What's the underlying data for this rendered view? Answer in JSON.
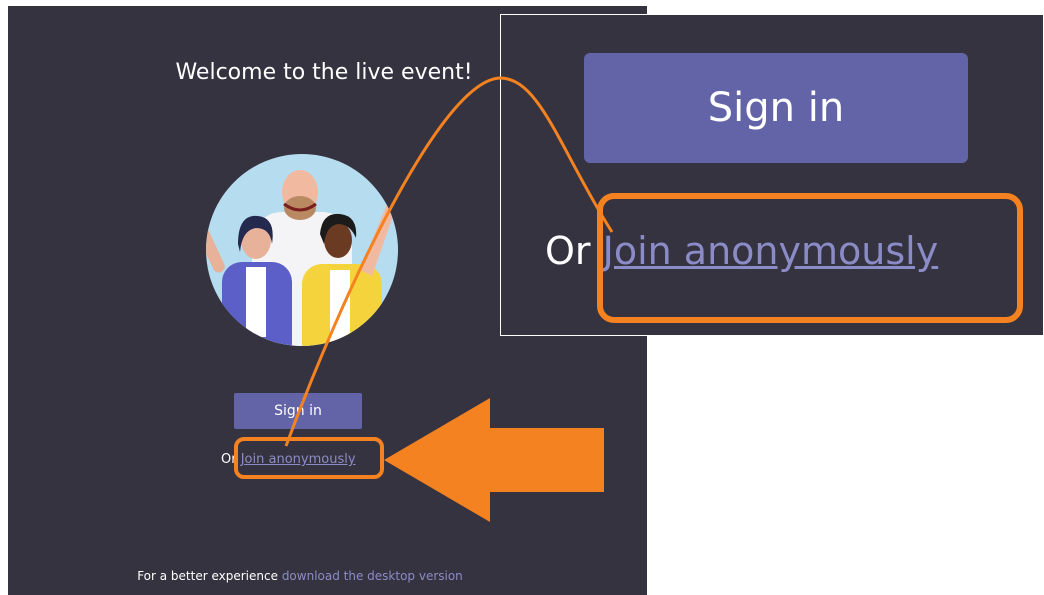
{
  "welcome": {
    "title": "Welcome to the live event!"
  },
  "signin": {
    "label": "Sign in"
  },
  "join": {
    "or_text": "Or ",
    "link_text": "Join anonymously"
  },
  "footer": {
    "prefix": "For a better experience ",
    "link_text": "download the desktop version"
  },
  "zoom": {
    "signin_label": "Sign in",
    "or_text": "Or ",
    "link_text": "Join anonymously"
  },
  "colors": {
    "panel_bg": "#35333f",
    "brand_purple": "#6264a7",
    "link": "#8b8cc7",
    "annotation_orange": "#f58220"
  }
}
